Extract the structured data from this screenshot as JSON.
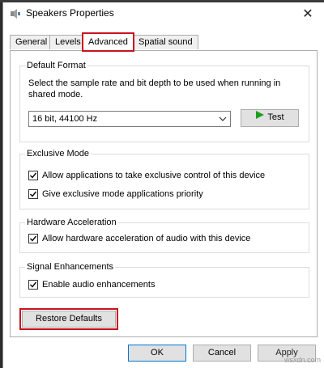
{
  "window": {
    "title": "Speakers Properties",
    "close_glyph": "✕"
  },
  "tabs": [
    {
      "label": "General",
      "active": false
    },
    {
      "label": "Levels",
      "active": false
    },
    {
      "label": "Advanced",
      "active": true
    },
    {
      "label": "Spatial sound",
      "active": false
    }
  ],
  "default_format": {
    "legend": "Default Format",
    "description": "Select the sample rate and bit depth to be used when running in shared mode.",
    "selected_format": "16 bit, 44100 Hz",
    "test_label": "Test"
  },
  "exclusive_mode": {
    "legend": "Exclusive Mode",
    "options": [
      {
        "label": "Allow applications to take exclusive control of this device",
        "checked": true
      },
      {
        "label": "Give exclusive mode applications priority",
        "checked": true
      }
    ]
  },
  "hardware_acceleration": {
    "legend": "Hardware Acceleration",
    "option": {
      "label": "Allow hardware acceleration of audio with this device",
      "checked": true
    }
  },
  "signal_enhancements": {
    "legend": "Signal Enhancements",
    "option": {
      "label": "Enable audio enhancements",
      "checked": true
    }
  },
  "restore_defaults_label": "Restore Defaults",
  "footer": {
    "ok_label": "OK",
    "cancel_label": "Cancel",
    "apply_label": "Apply"
  },
  "watermark": "wsxdn.com",
  "colors": {
    "highlight_red": "#c8141e",
    "primary_blue": "#0078d7",
    "test_green": "#1e9e1e"
  }
}
